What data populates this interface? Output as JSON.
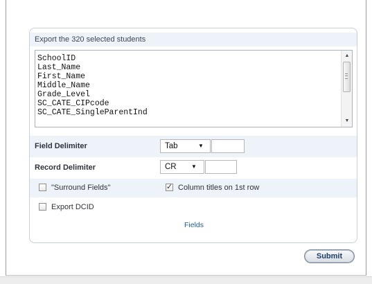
{
  "export_panel": {
    "header_text": "Export the 320 selected students",
    "field_list": [
      "SchoolID",
      "Last_Name",
      "First_Name",
      "Middle_Name",
      "Grade_Level",
      "SC_CATE_CIPcode",
      "SC_CATE_SingleParentInd"
    ]
  },
  "field_delimiter": {
    "label": "Field Delimiter",
    "selected": "Tab",
    "custom_value": ""
  },
  "record_delimiter": {
    "label": "Record Delimiter",
    "selected": "CR",
    "custom_value": ""
  },
  "options": {
    "surround_fields": {
      "label": "\"Surround Fields\"",
      "checked": false
    },
    "column_titles": {
      "label": "Column titles on 1st row",
      "checked": true
    },
    "export_dcid": {
      "label": "Export DCID",
      "checked": false
    }
  },
  "fields_link": "Fields",
  "submit_label": "Submit",
  "icons": {
    "scroll_up": "scroll-up-arrow-icon",
    "scroll_down": "scroll-down-arrow-icon",
    "dropdown": "chevron-down-icon"
  }
}
